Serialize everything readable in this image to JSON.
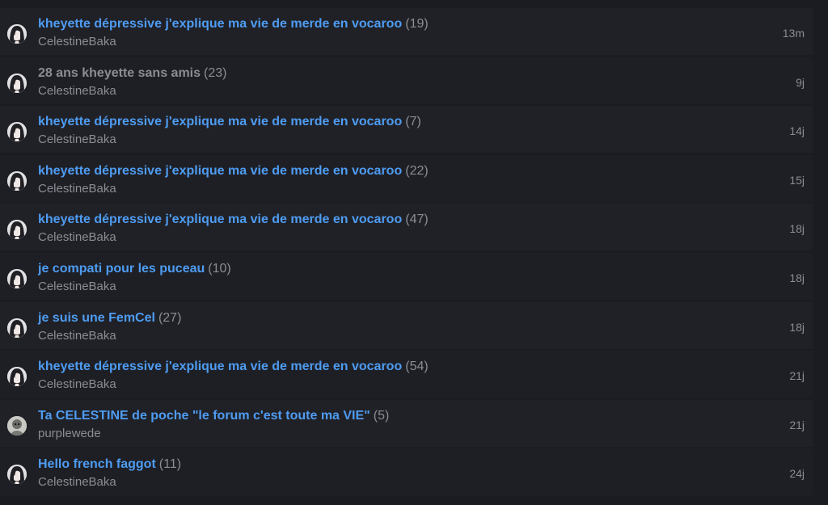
{
  "topics": [
    {
      "title": "kheyette dépressive j'explique ma vie de merde en vocaroo",
      "count": "(19)",
      "author": "CelestineBaka",
      "time": "13m",
      "avatar": "dark-hair-avatar",
      "visited": false
    },
    {
      "title": "28 ans kheyette sans amis",
      "count": "(23)",
      "author": "CelestineBaka",
      "time": "9j",
      "avatar": "dark-hair-avatar",
      "visited": true
    },
    {
      "title": "kheyette dépressive j'explique ma vie de merde en vocaroo",
      "count": "(7)",
      "author": "CelestineBaka",
      "time": "14j",
      "avatar": "dark-hair-avatar",
      "visited": false
    },
    {
      "title": "kheyette dépressive j'explique ma vie de merde en vocaroo",
      "count": "(22)",
      "author": "CelestineBaka",
      "time": "15j",
      "avatar": "dark-hair-avatar",
      "visited": false
    },
    {
      "title": "kheyette dépressive j'explique ma vie de merde en vocaroo",
      "count": "(47)",
      "author": "CelestineBaka",
      "time": "18j",
      "avatar": "dark-hair-avatar",
      "visited": false
    },
    {
      "title": "je compati pour les puceau",
      "count": "(10)",
      "author": "CelestineBaka",
      "time": "18j",
      "avatar": "dark-hair-avatar",
      "visited": false
    },
    {
      "title": "je suis une FemCel",
      "count": "(27)",
      "author": "CelestineBaka",
      "time": "18j",
      "avatar": "dark-hair-avatar",
      "visited": false
    },
    {
      "title": "kheyette dépressive j'explique ma vie de merde en vocaroo",
      "count": "(54)",
      "author": "CelestineBaka",
      "time": "21j",
      "avatar": "dark-hair-avatar",
      "visited": false
    },
    {
      "title": "Ta CELESTINE de poche \"le forum c'est toute ma VIE\"",
      "count": "(5)",
      "author": "purplewede",
      "time": "21j",
      "avatar": "grey-avatar",
      "visited": false
    },
    {
      "title": "Hello french faggot",
      "count": "(11)",
      "author": "CelestineBaka",
      "time": "24j",
      "avatar": "dark-hair-avatar",
      "visited": false
    }
  ],
  "colors": {
    "background": "#1b1c21",
    "row": "#202127",
    "link": "#4e9cf2",
    "muted": "#8b8d94"
  }
}
